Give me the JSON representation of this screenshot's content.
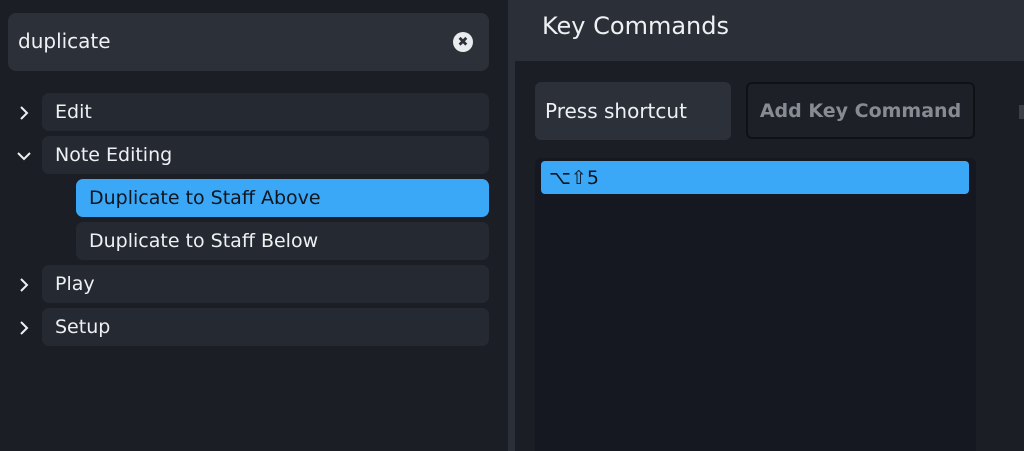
{
  "search": {
    "value": "duplicate"
  },
  "tree": [
    {
      "label": "Edit",
      "expanded": false
    },
    {
      "label": "Note Editing",
      "expanded": true,
      "children": [
        {
          "label": "Duplicate to Staff Above",
          "selected": true
        },
        {
          "label": "Duplicate to Staff Below",
          "selected": false
        }
      ]
    },
    {
      "label": "Play",
      "expanded": false
    },
    {
      "label": "Setup",
      "expanded": false
    }
  ],
  "panel": {
    "title": "Key Commands",
    "shortcut_label": "Press shortcut",
    "add_label": "Add Key Command",
    "commands": [
      "⌥⇧5"
    ]
  },
  "colors": {
    "accent": "#3aa8f7",
    "panel": "#2b3038",
    "background": "#1b1e24"
  }
}
